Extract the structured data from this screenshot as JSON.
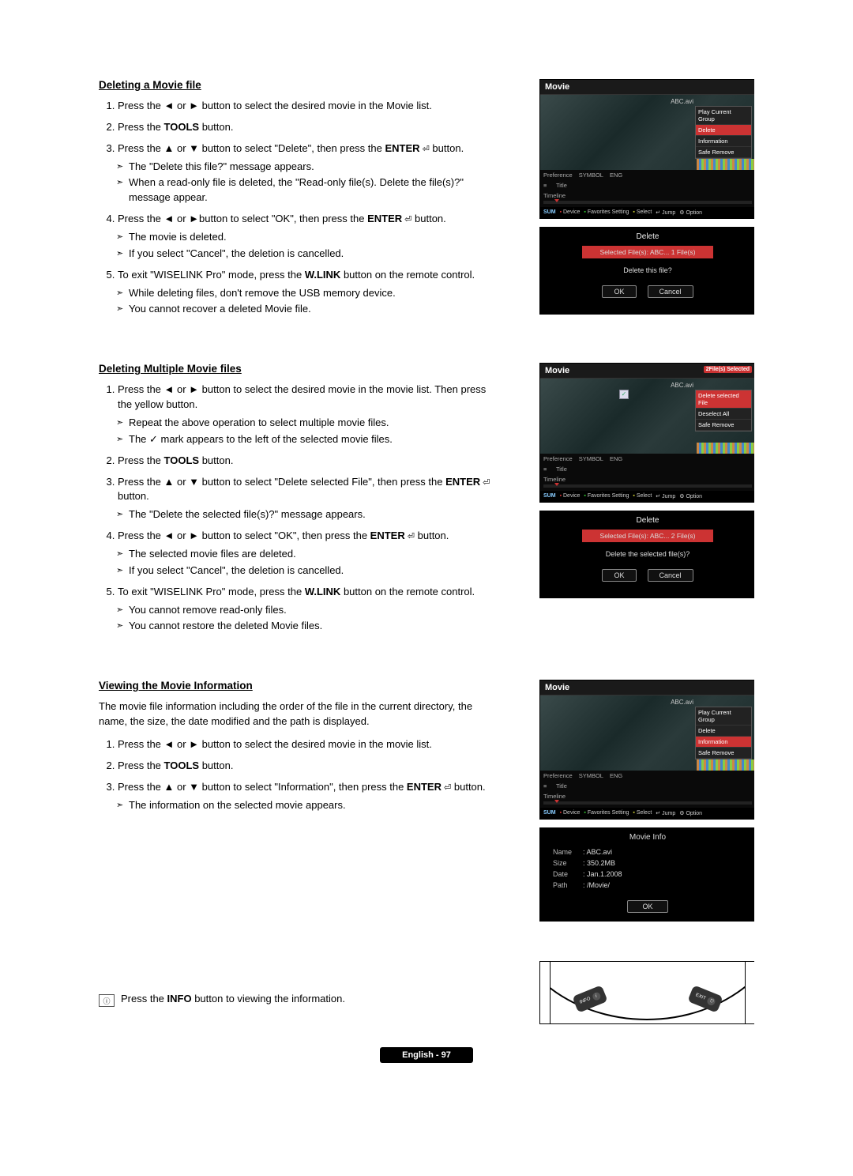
{
  "s1": {
    "heading": "Deleting a Movie file",
    "step1": "Press the ◄ or ► button to select the desired movie in the Movie list.",
    "step2a": "Press the ",
    "step2b": "TOOLS",
    "step2c": " button.",
    "step3a": "Press the ▲ or ▼ button to select \"Delete\", then press the ",
    "step3b": "ENTER",
    "step3c": " button.",
    "step3s1": "The \"Delete this file?\" message appears.",
    "step3s2": "When a read-only file is deleted, the \"Read-only file(s). Delete the file(s)?\" message appear.",
    "step4a": "Press the ◄ or ►button to select \"OK\", then press the ",
    "step4b": "ENTER",
    "step4c": " button.",
    "step4s1": "The movie is deleted.",
    "step4s2": "If you select \"Cancel\", the deletion is cancelled.",
    "step5a": "To exit \"WISELINK Pro\" mode, press the ",
    "step5b": "W.LINK",
    "step5c": " button on the remote control.",
    "step5s1": "While deleting files, don't remove the USB memory device.",
    "step5s2": "You cannot recover a deleted Movie file."
  },
  "tv1": {
    "title": "Movie",
    "file": "ABC.avi",
    "m1": "Play Current Group",
    "m2": "Delete",
    "m3": "Information",
    "m4": "Safe Remove",
    "pref": "Preference",
    "sym": "SYMBOL",
    "eng": "ENG",
    "titleTab": "Title",
    "timeline": "Timeline",
    "sum": "SUM",
    "dev": "Device",
    "fav": "Favorites Setting",
    "sel": "Select",
    "jump": "Jump",
    "opt": "Option"
  },
  "dlg1": {
    "title": "Delete",
    "sel": "Selected File(s): ABC...   1 File(s)",
    "msg": "Delete this file?",
    "ok": "OK",
    "cancel": "Cancel"
  },
  "s2": {
    "heading": "Deleting Multiple Movie files",
    "step1": "Press the ◄ or ► button to select the desired movie in the movie list. Then press the yellow button.",
    "step1s1": "Repeat the above operation to select multiple movie files.",
    "step1s2a": "The ",
    "step1s2b": "✓",
    "step1s2c": " mark appears to the left of the selected movie files.",
    "step2a": "Press the ",
    "step2b": "TOOLS",
    "step2c": " button.",
    "step3a": "Press the ▲ or ▼ button to select \"Delete selected File\", then press the ",
    "step3b": "ENTER",
    "step3c": " button.",
    "step3s1": "The \"Delete the selected file(s)?\" message appears.",
    "step4a": "Press the ◄ or ► button to select \"OK\", then press the ",
    "step4b": "ENTER",
    "step4c": " button.",
    "step4s1": "The selected movie files are deleted.",
    "step4s2": "If you select \"Cancel\", the deletion is cancelled.",
    "step5a": "To exit \"WISELINK Pro\" mode, press the ",
    "step5b": "W.LINK",
    "step5c": " button on the remote control.",
    "step5s1": "You cannot remove read-only files.",
    "step5s2": "You cannot restore the deleted Movie files."
  },
  "tv2": {
    "title": "Movie",
    "badge": "2File(s) Selected",
    "file": "ABC.avi",
    "m1": "Delete selected File",
    "m2": "Deselect All",
    "m3": "Safe Remove"
  },
  "dlg2": {
    "title": "Delete",
    "sel": "Selected File(s): ABC...   2 File(s)",
    "msg": "Delete the selected file(s)?",
    "ok": "OK",
    "cancel": "Cancel"
  },
  "s3": {
    "heading": "Viewing the Movie Information",
    "intro": "The movie file information including the order of the file in the current directory, the name, the size, the date modified and the path is displayed.",
    "step1": "Press the ◄ or ► button to select the desired movie in the movie list.",
    "step2a": "Press the ",
    "step2b": "TOOLS",
    "step2c": " button.",
    "step3a": "Press the ▲ or ▼ button to select \"Information\", then press the ",
    "step3b": "ENTER",
    "step3c": "  button.",
    "step3s1": "The information on the selected movie appears."
  },
  "tv3": {
    "title": "Movie",
    "file": "ABC.avi",
    "m1": "Play Current Group",
    "m2": "Delete",
    "m3": "Information",
    "m4": "Safe Remove"
  },
  "info": {
    "title": "Movie Info",
    "nameK": "Name",
    "nameV": ": ABC.avi",
    "sizeK": "Size",
    "sizeV": ": 350.2MB",
    "dateK": "Date",
    "dateV": ": Jan.1.2008",
    "pathK": "Path",
    "pathV": ": /Movie/",
    "ok": "OK"
  },
  "note": {
    "icon": "ⓘ",
    "textA": "Press the ",
    "textB": "INFO",
    "textC": " button to viewing the information."
  },
  "remote": {
    "info": "INFO",
    "exit": "EXIT"
  },
  "footer": "English - 97"
}
